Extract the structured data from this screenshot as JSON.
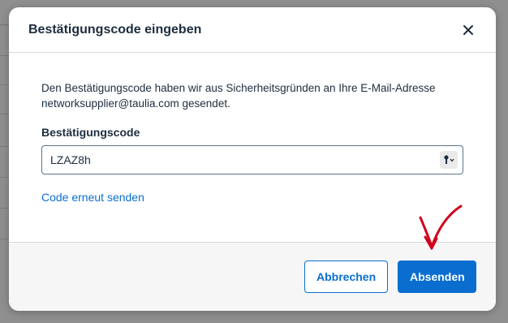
{
  "dialog": {
    "title": "Bestätigungscode eingeben",
    "close_icon": "close-icon",
    "info_text_line1": "Den Bestätigungscode haben wir aus Sicherheitsgründen an Ihre E-Mail-Adresse",
    "info_text_line2": "networksupplier@taulia.com gesendet.",
    "field_label": "Bestätigungscode",
    "field_value": "LZAZ8h",
    "field_icon": "key-icon",
    "resend_label": "Code erneut senden",
    "cancel_label": "Abbrechen",
    "submit_label": "Absenden"
  },
  "colors": {
    "accent": "#0a6ed1",
    "text": "#1d2d3e",
    "annotation": "#d0021b"
  }
}
